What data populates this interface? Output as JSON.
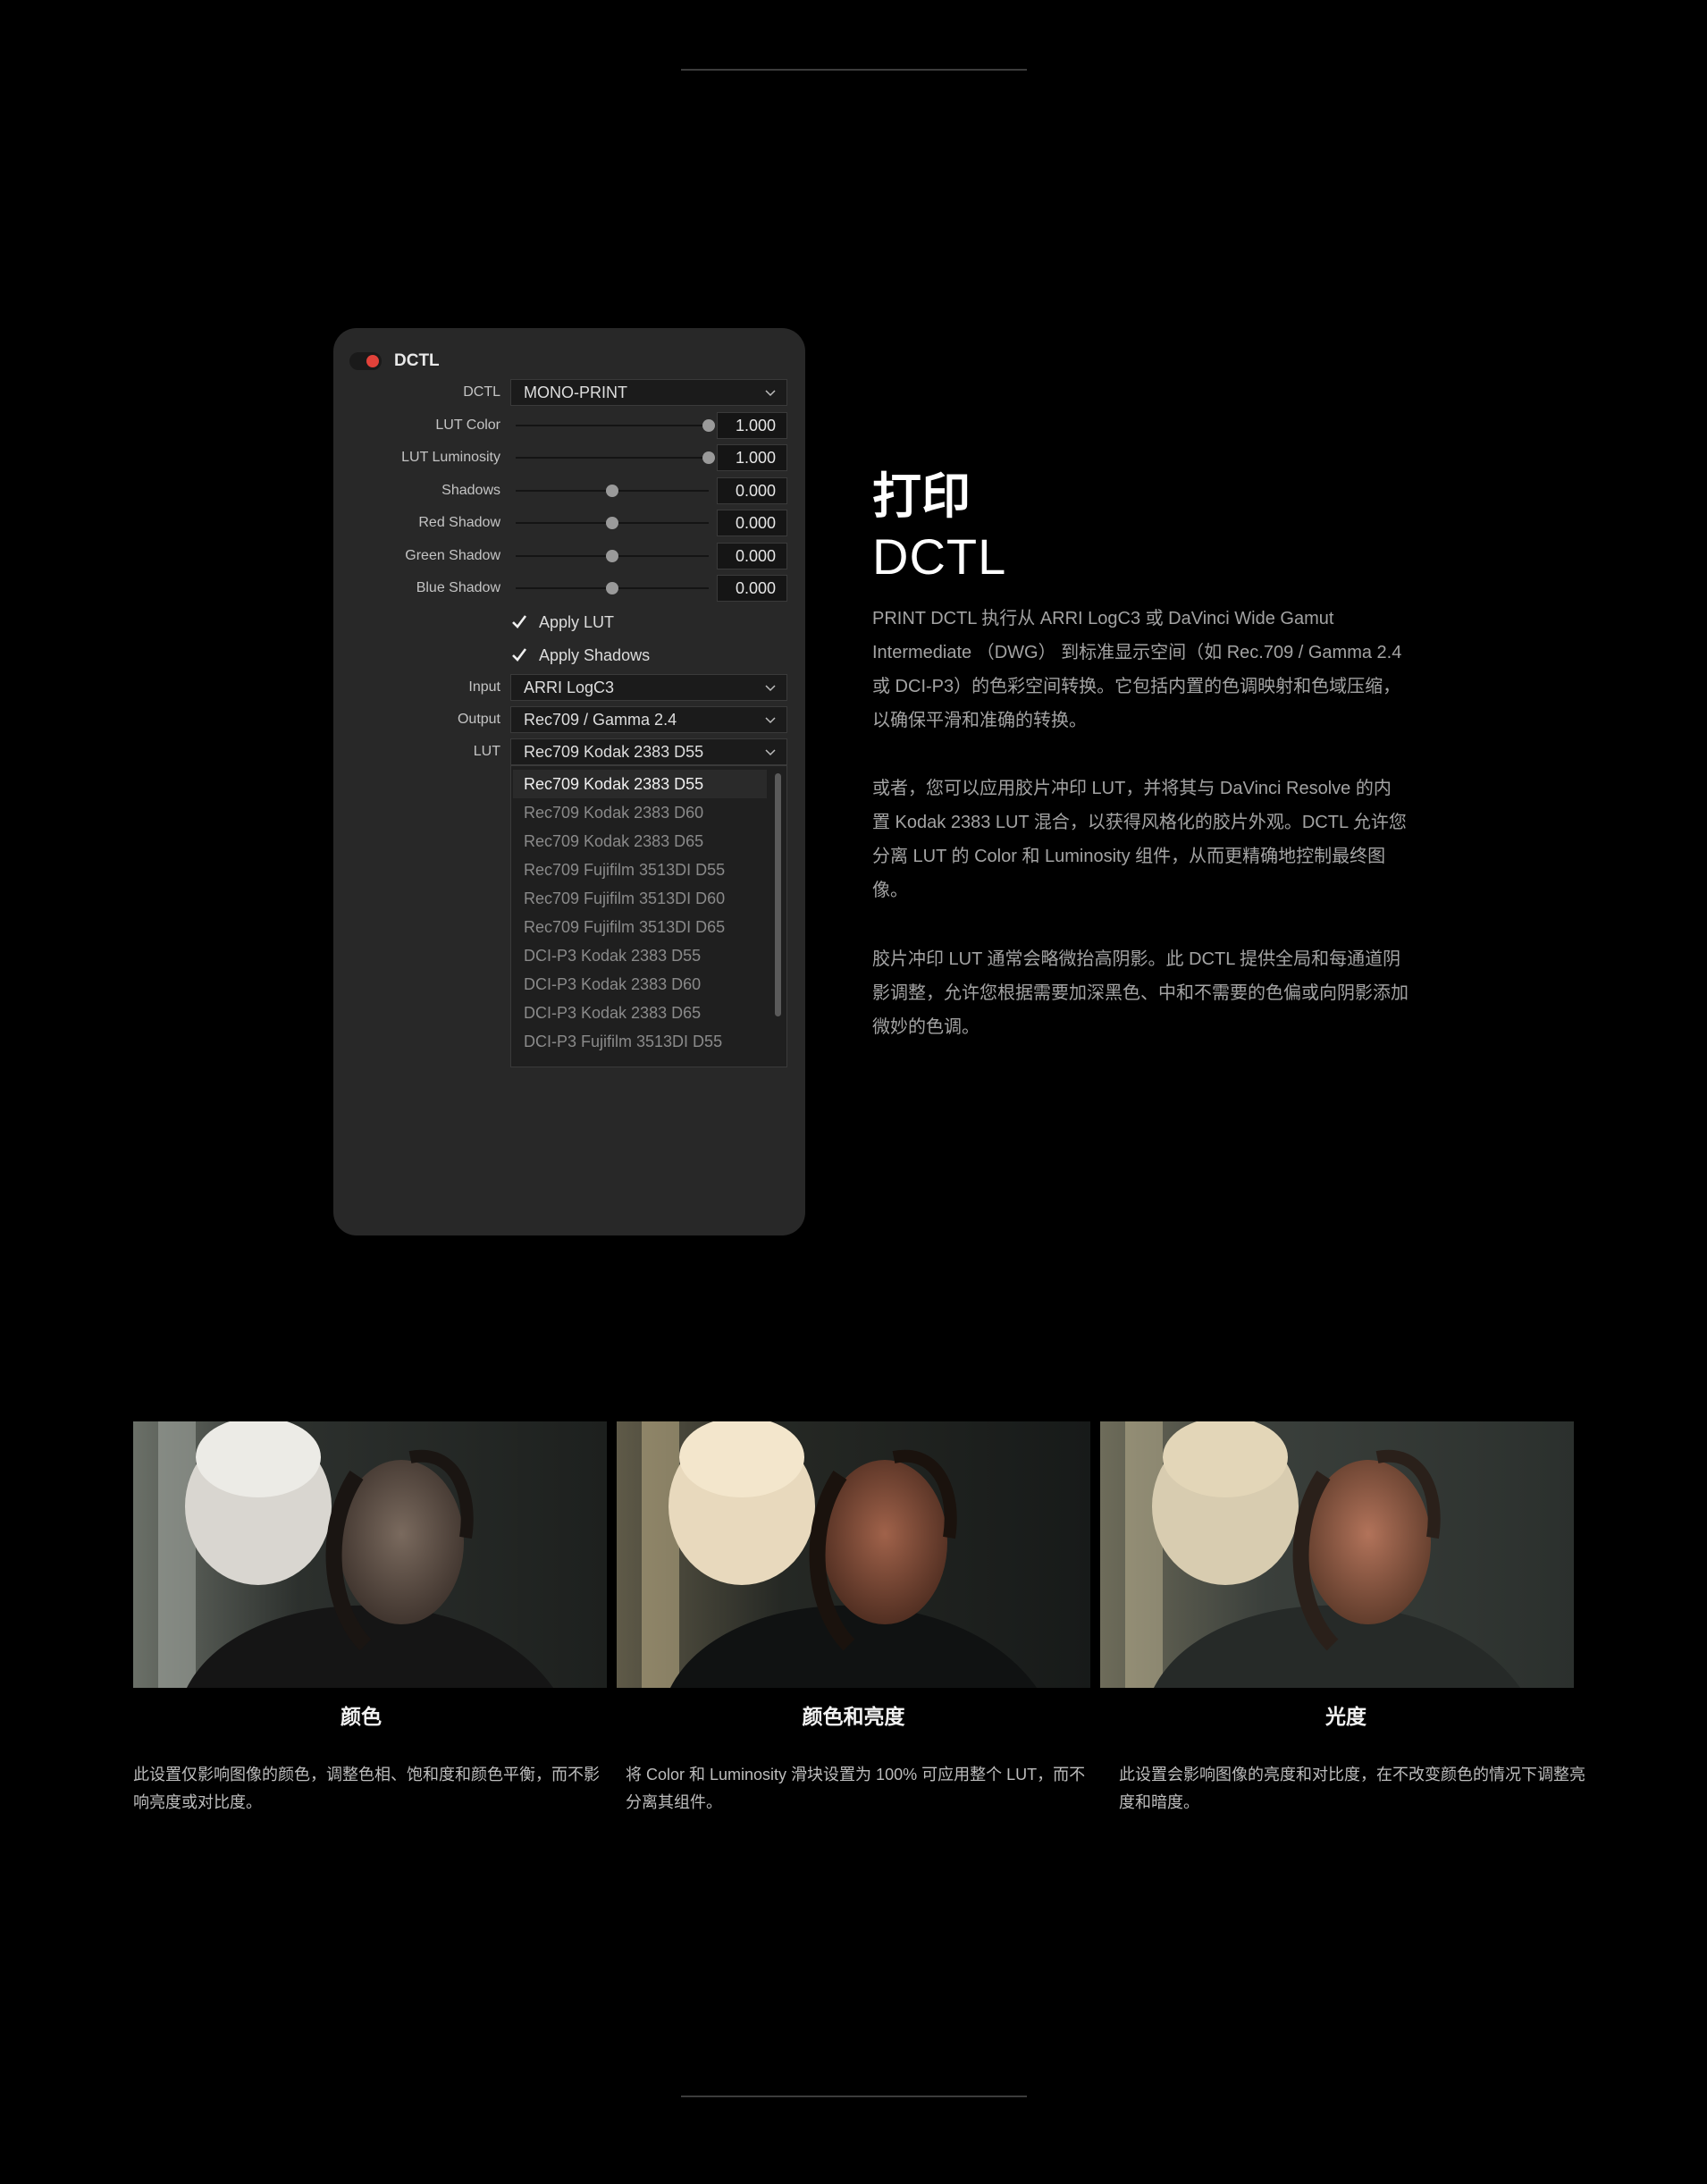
{
  "panel": {
    "title": "DCTL",
    "dctl_label": "DCTL",
    "dctl_value": "MONO-PRINT",
    "sliders": [
      {
        "label": "LUT Color",
        "value": "1.000",
        "position": 1.0
      },
      {
        "label": "LUT Luminosity",
        "value": "1.000",
        "position": 1.0
      },
      {
        "label": "Shadows",
        "value": "0.000",
        "position": 0.5
      },
      {
        "label": "Red Shadow",
        "value": "0.000",
        "position": 0.5
      },
      {
        "label": "Green Shadow",
        "value": "0.000",
        "position": 0.5
      },
      {
        "label": "Blue Shadow",
        "value": "0.000",
        "position": 0.5
      }
    ],
    "checkboxes": [
      {
        "label": "Apply LUT",
        "checked": true
      },
      {
        "label": "Apply Shadows",
        "checked": true
      }
    ],
    "input_label": "Input",
    "input_value": "ARRI LogC3",
    "output_label": "Output",
    "output_value": "Rec709 / Gamma 2.4",
    "lut_label": "LUT",
    "lut_value": "Rec709 Kodak 2383 D55",
    "lut_options": [
      "Rec709 Kodak 2383 D55",
      "Rec709 Kodak 2383 D60",
      "Rec709 Kodak 2383 D65",
      "Rec709 Fujifilm 3513DI D55",
      "Rec709 Fujifilm 3513DI D60",
      "Rec709 Fujifilm 3513DI D65",
      "DCI-P3 Kodak 2383 D55",
      "DCI-P3 Kodak 2383 D60",
      "DCI-P3 Kodak 2383 D65",
      "DCI-P3 Fujifilm 3513DI D55"
    ],
    "toggle_color": "#e2423a"
  },
  "section": {
    "title_cn": "打印",
    "title_en": "DCTL",
    "paragraphs": [
      "PRINT DCTL 执行从 ARRI LogC3 或 DaVinci Wide Gamut Intermediate （DWG） 到标准显示空间（如 Rec.709 / Gamma 2.4 或 DCI-P3）的色彩空间转换。它包括内置的色调映射和色域压缩，以确保平滑和准确的转换。",
      "或者，您可以应用胶片冲印 LUT，并将其与 DaVinci Resolve 的内置 Kodak 2383 LUT 混合，以获得风格化的胶片外观。DCTL 允许您分离 LUT 的 Color 和 Luminosity 组件，从而更精确地控制最终图像。",
      "胶片冲印 LUT 通常会略微抬高阴影。此 DCTL 提供全局和每通道阴影调整，允许您根据需要加深黑色、中和不需要的色偏或向阴影添加微妙的色调。"
    ]
  },
  "cards": [
    {
      "title": "颜色",
      "description": "此设置仅影响图像的颜色，调整色相、饱和度和颜色平衡，而不影响亮度或对比度。"
    },
    {
      "title": "颜色和亮度",
      "description": "将 Color 和 Luminosity 滑块设置为 100% 可应用整个 LUT，而不分离其组件。"
    },
    {
      "title": "光度",
      "description": "此设置会影响图像的亮度和对比度，在不改变颜色的情况下调整亮度和暗度。"
    }
  ]
}
